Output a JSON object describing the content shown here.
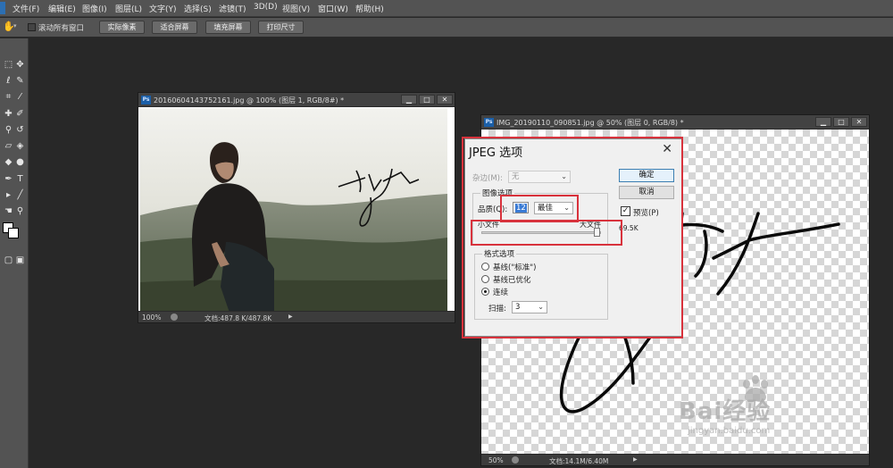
{
  "menubar": {
    "items": [
      "文件(F)",
      "编辑(E)",
      "图像(I)",
      "图层(L)",
      "文字(Y)",
      "选择(S)",
      "滤镜(T)",
      "3D(D)",
      "视图(V)",
      "窗口(W)",
      "帮助(H)"
    ]
  },
  "optionsbar": {
    "scroll_all_label": "滚动所有窗口",
    "buttons": [
      "实际像素",
      "适合屏幕",
      "填充屏幕",
      "打印尺寸"
    ]
  },
  "toolbar": {
    "tools": [
      "move-tool",
      "marquee-tool",
      "lasso-tool",
      "quick-select-tool",
      "crop-tool",
      "eyedropper-tool",
      "healing-brush-tool",
      "brush-tool",
      "clone-stamp-tool",
      "history-brush-tool",
      "eraser-tool",
      "gradient-tool",
      "blur-tool",
      "dodge-tool",
      "pen-tool",
      "type-tool",
      "path-select-tool",
      "shape-tool",
      "hand-tool",
      "zoom-tool"
    ]
  },
  "doc1": {
    "icon": "Ps",
    "title": "20160604143752161.jpg @ 100% (图层 1, RGB/8#) *",
    "zoom": "100%",
    "doc_info": "文档:487.8 K/487.8K",
    "signature_text": "李健"
  },
  "doc2": {
    "icon": "Ps",
    "title": "IMG_20190110_090851.jpg @ 50% (图层 0, RGB/8) *",
    "zoom": "50%",
    "doc_info": "文档:14.1M/6.40M"
  },
  "dialog": {
    "title": "JPEG 选项",
    "matte_label": "杂边(M):",
    "matte_value": "无",
    "image_options_label": "图像选项",
    "quality_label": "品质(Q):",
    "quality_value": "12",
    "quality_preset": "最佳",
    "small_file_label": "小文件",
    "large_file_label": "大文件",
    "quality_slider_fraction": 1.0,
    "ok_label": "确定",
    "cancel_label": "取消",
    "preview_label": "预览(P)",
    "preview_checked": true,
    "file_size": "69.5K",
    "format_options_label": "格式选项",
    "format_options": [
      "基线(\"标准\")",
      "基线已优化",
      "连续"
    ],
    "selected_format_index": 2,
    "scans_label": "扫描:",
    "scans_value": "3"
  },
  "watermark": {
    "brand": "Bai经验",
    "url": "jingyan.baidu.com"
  },
  "colors": {
    "highlight_red": "#d8323c",
    "canvas_bg": "#282828",
    "panel_bg": "#535353"
  }
}
